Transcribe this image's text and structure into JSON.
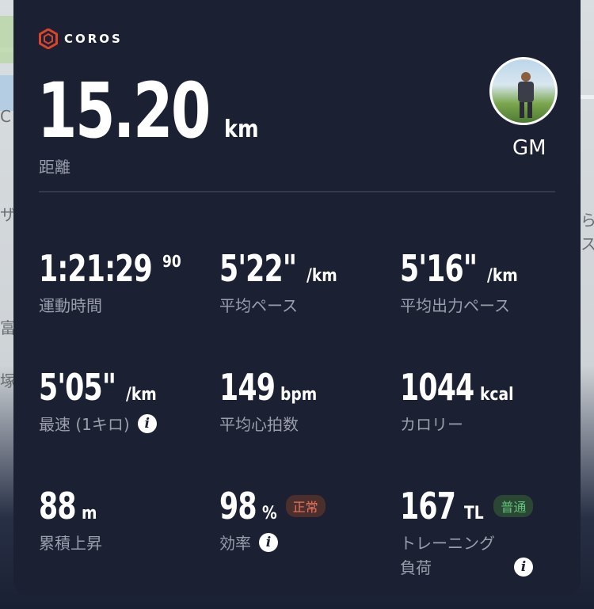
{
  "map": {
    "labels": [
      "C",
      "ザ",
      "ら",
      "ス",
      "富",
      "塚"
    ]
  },
  "brand": {
    "name": "COROS"
  },
  "hero": {
    "value": "15.20",
    "unit": "km",
    "label": "距離"
  },
  "user": {
    "initials": "GM"
  },
  "stats": {
    "time": {
      "value": "1:21:29",
      "sup": "90",
      "label": "運動時間"
    },
    "avg_pace": {
      "value": "5'22\"",
      "unit": "/km",
      "label": "平均ペース"
    },
    "avg_power_pace": {
      "value": "5'16\"",
      "unit": "/km",
      "label": "平均出力ペース"
    },
    "fastest_km": {
      "value": "5'05\"",
      "unit": "/km",
      "label": "最速 (1キロ)"
    },
    "avg_hr": {
      "value": "149",
      "unit": "bpm",
      "label": "平均心拍数"
    },
    "calories": {
      "value": "1044",
      "unit": "kcal",
      "label": "カロリー"
    },
    "ascent": {
      "value": "88",
      "unit": "m",
      "label": "累積上昇"
    },
    "efficiency": {
      "value": "98",
      "unit": "%",
      "label": "効率",
      "badge": "正常"
    },
    "training_load": {
      "value": "167",
      "unit": "TL",
      "label_line1": "トレーニング",
      "label_line2": "負荷",
      "badge": "普通"
    }
  },
  "colors": {
    "card_bg": "#1c2033",
    "label_gray": "#9a9eac",
    "brand_red": "#d9442b",
    "badge_normal": "#e9735c",
    "badge_mid": "#63c37a"
  },
  "icons": [
    "coros-logo-icon",
    "info-icon"
  ]
}
